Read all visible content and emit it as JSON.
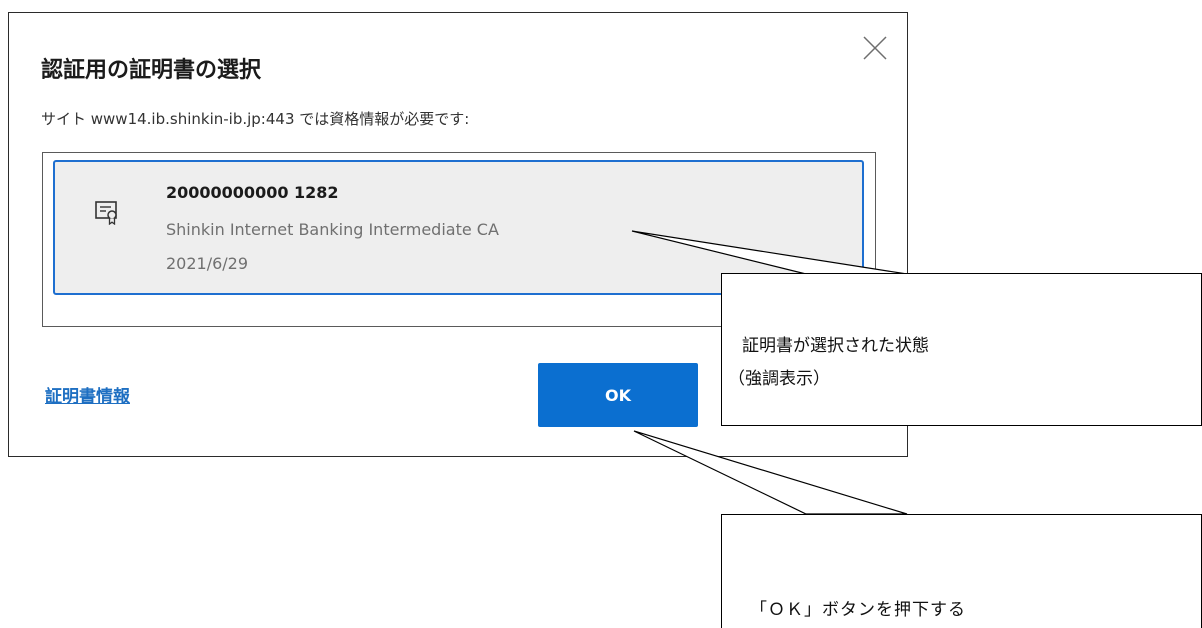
{
  "dialog": {
    "title": "認証用の証明書の選択",
    "subtitle": "サイト www14.ib.shinkin-ib.jp:443 では資格情報が必要です:",
    "close_icon": "close-icon",
    "certificate": {
      "name": "20000000000  1282",
      "issuer": "Shinkin Internet Banking Intermediate CA",
      "date": "2021/6/29",
      "icon": "certificate-icon",
      "selected": true
    },
    "cert_info_link": "証明書情報",
    "ok_label": "OK",
    "colors": {
      "accent": "#0b6fd0",
      "selected_border": "#1e6fd0",
      "selected_background": "#eeeeee",
      "link": "#1e6fc2"
    }
  },
  "annotations": {
    "callout1_line1": "証明書が選択された状態",
    "callout1_line2": "（強調表示）",
    "callout2_text": "「ＯＫ」ボタンを押下する"
  }
}
